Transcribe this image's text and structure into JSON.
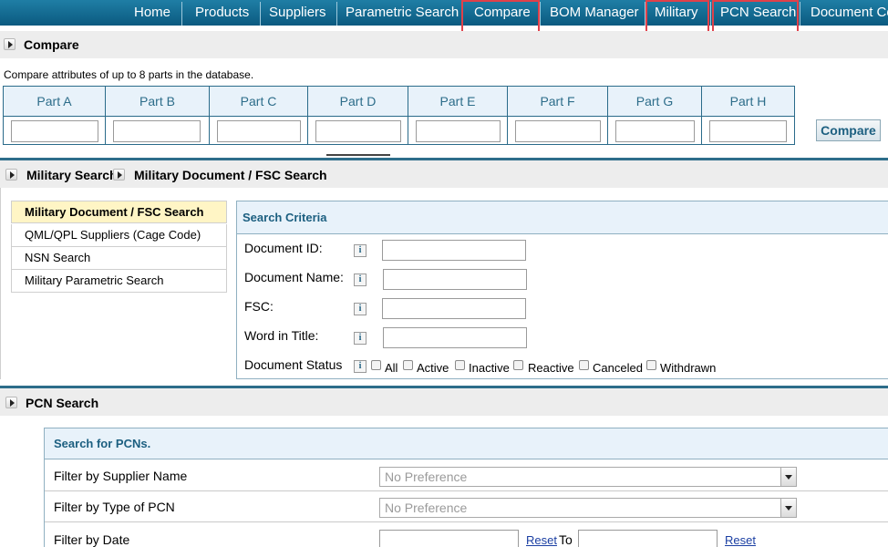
{
  "nav": {
    "items": [
      "Home",
      "Products",
      "Suppliers",
      "Parametric Search",
      "Compare",
      "BOM Manager",
      "Military",
      "PCN Search",
      "Document Ce"
    ]
  },
  "compare": {
    "title": "Compare",
    "description": "Compare attributes of up to 8 parts in the database.",
    "parts": [
      "Part A",
      "Part B",
      "Part C",
      "Part D",
      "Part E",
      "Part F",
      "Part G",
      "Part H"
    ],
    "button": "Compare"
  },
  "military": {
    "breadcrumb_1": "Military Search",
    "breadcrumb_2": "Military Document / FSC Search",
    "sidebar": [
      "Military Document / FSC Search",
      "QML/QPL Suppliers (Cage Code)",
      "NSN Search",
      "Military Parametric Search"
    ],
    "criteria_title": "Search Criteria",
    "fields": [
      "Document ID:",
      "Document Name:",
      "FSC:",
      "Word in Title:"
    ],
    "info_glyph": "i",
    "status_label": "Document Status",
    "statuses": [
      "All",
      "Active",
      "Inactive",
      "Reactive",
      "Canceled",
      "Withdrawn"
    ]
  },
  "pcn": {
    "title": "PCN Search",
    "box_title": "Search for PCNs.",
    "supplier_label": "Filter by Supplier Name",
    "supplier_value": "No Preference",
    "type_label": "Filter by Type of PCN",
    "type_value": "No Preference",
    "date_label": "Filter by Date",
    "reset_1": "Reset",
    "to_label": "To",
    "reset_2": "Reset"
  },
  "colors": {
    "nav_bg": "#0b5a80",
    "highlight": "#e0414a",
    "accent": "#1c5f80",
    "active_item_bg": "#fff5c5"
  }
}
